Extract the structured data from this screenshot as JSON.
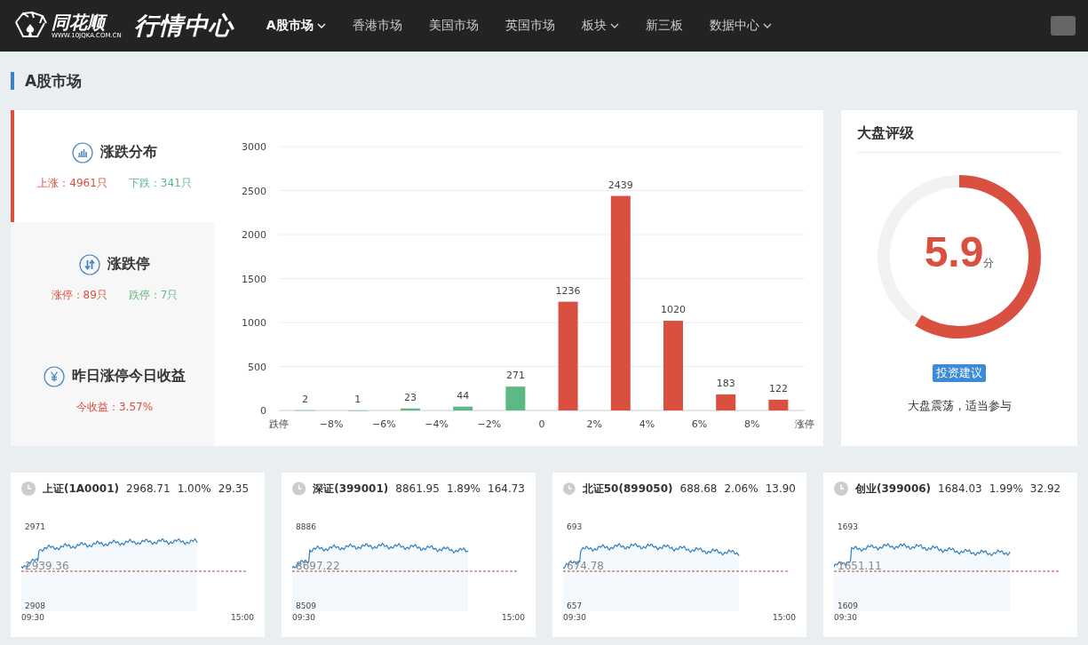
{
  "header": {
    "logo_text": "同花顺",
    "logo_url": "WWW.10JQKA.COM.CN",
    "site_title": "行情中心",
    "nav": [
      {
        "label": "A股市场",
        "selected": true,
        "dropdown": true
      },
      {
        "label": "香港市场",
        "selected": false,
        "dropdown": false
      },
      {
        "label": "美国市场",
        "selected": false,
        "dropdown": false
      },
      {
        "label": "英国市场",
        "selected": false,
        "dropdown": false
      },
      {
        "label": "板块",
        "selected": false,
        "dropdown": true
      },
      {
        "label": "新三板",
        "selected": false,
        "dropdown": false
      },
      {
        "label": "数据中心",
        "selected": false,
        "dropdown": true
      }
    ]
  },
  "section_title": "A股市场",
  "stats_tabs": [
    {
      "title": "涨跌分布",
      "selected": true,
      "stats": [
        {
          "text": "上涨：4961只",
          "kind": "up"
        },
        {
          "text": "下跌：341只",
          "kind": "down"
        }
      ]
    },
    {
      "title": "涨跌停",
      "selected": false,
      "stats": [
        {
          "text": "涨停：89只",
          "kind": "up"
        },
        {
          "text": "跌停：7只",
          "kind": "down"
        }
      ]
    },
    {
      "title": "昨日涨停今日收益",
      "selected": false,
      "stats": [
        {
          "text": "今收益：3.57%",
          "kind": "up"
        }
      ]
    }
  ],
  "distribution_chart": {
    "chart_data": {
      "type": "bar",
      "x": [
        -9,
        -7,
        -5,
        -3,
        -1,
        1,
        3,
        5,
        7,
        9
      ],
      "series": [
        {
          "color": "#5cb885",
          "values": [
            2,
            1,
            23,
            44,
            271,
            null,
            null,
            null,
            null,
            null
          ]
        },
        {
          "color": "#d95040",
          "values": [
            null,
            null,
            null,
            null,
            null,
            1236,
            2439,
            1020,
            183,
            122
          ]
        }
      ],
      "xlim": [
        -10,
        10
      ],
      "ylim": [
        0,
        3000
      ],
      "grid": true,
      "xticks": [
        {
          "value": -10,
          "label": "跌停"
        },
        {
          "value": -8,
          "label": "−8%"
        },
        {
          "value": -6,
          "label": "−6%"
        },
        {
          "value": -4,
          "label": "−4%"
        },
        {
          "value": -2,
          "label": "−2%"
        },
        {
          "value": 0,
          "label": "0"
        },
        {
          "value": 2,
          "label": "2%"
        },
        {
          "value": 4,
          "label": "4%"
        },
        {
          "value": 6,
          "label": "6%"
        },
        {
          "value": 8,
          "label": "8%"
        },
        {
          "value": 10,
          "label": "涨停"
        }
      ],
      "yticks": [
        0,
        500,
        1000,
        1500,
        2000,
        2500,
        3000
      ],
      "data_labels": true
    }
  },
  "rating": {
    "title": "大盘评级",
    "score": "5.9",
    "unit": "分",
    "level": 0.59,
    "badge": "投资建议",
    "advice": "大盘震荡，适当参与"
  },
  "indices": [
    {
      "name": "上证(1A0001)",
      "price": "2968.71",
      "change_pct": "1.00%",
      "change": "29.35",
      "high": "2971",
      "prev_close": "2939.36",
      "low": "2908",
      "start_time": "09:30",
      "end_time": "15:00"
    },
    {
      "name": "深证(399001)",
      "price": "8861.95",
      "change_pct": "1.89%",
      "change": "164.73",
      "high": "8886",
      "prev_close": "8697.22",
      "low": "8509",
      "start_time": "09:30",
      "end_time": "15:00"
    },
    {
      "name": "北证50(899050)",
      "price": "688.68",
      "change_pct": "2.06%",
      "change": "13.90",
      "high": "693",
      "prev_close": "674.78",
      "low": "657",
      "start_time": "09:30",
      "end_time": "15:00"
    },
    {
      "name": "创业(399006)",
      "price": "1684.03",
      "change_pct": "1.99%",
      "change": "32.92",
      "high": "1693",
      "prev_close": "1651.11",
      "low": "1609",
      "start_time": "09:30"
    }
  ]
}
